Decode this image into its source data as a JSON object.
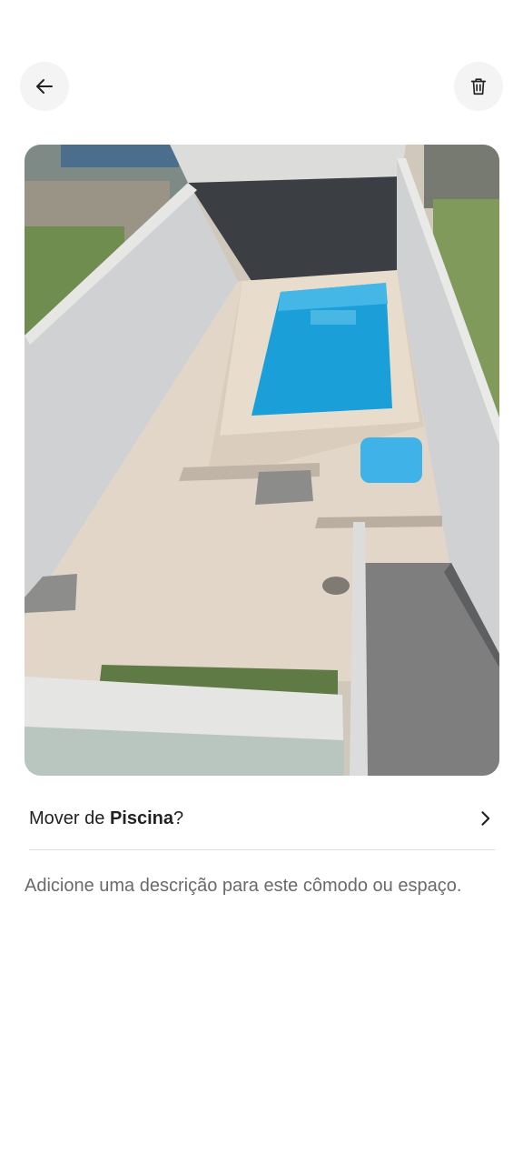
{
  "header": {
    "back_icon": "arrow-left-icon",
    "delete_icon": "trash-icon"
  },
  "photo": {
    "subject": "Piscina"
  },
  "move_row": {
    "prefix": "Mover de ",
    "room": "Piscina",
    "suffix": "?",
    "icon": "chevron-right-icon"
  },
  "description": {
    "placeholder": "Adicione uma descrição para este cômodo ou espaço."
  },
  "colors": {
    "text_primary": "#222222",
    "text_secondary": "#6a6a6a",
    "button_bg": "#f4f4f4",
    "divider": "#dddddd",
    "pool_water": "#1a9fd8"
  }
}
